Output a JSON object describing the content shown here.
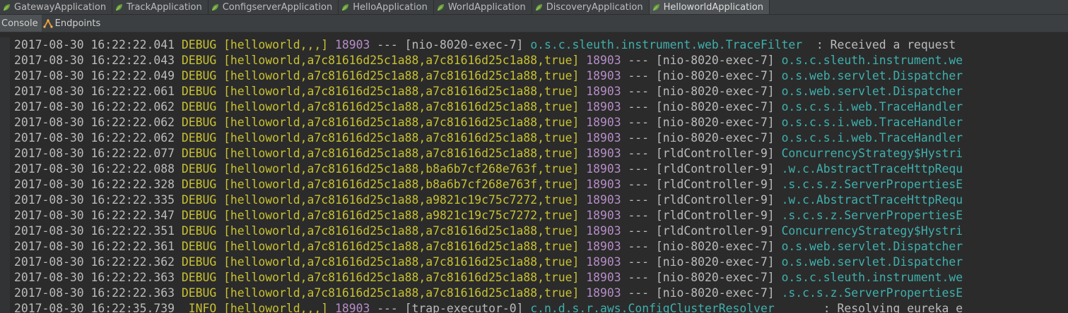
{
  "tabs": [
    {
      "label": "GatewayApplication",
      "icon": "spring-leaf-icon",
      "active": false
    },
    {
      "label": "TrackApplication",
      "icon": "spring-leaf-icon",
      "active": false
    },
    {
      "label": "ConfigserverApplication",
      "icon": "spring-leaf-icon",
      "active": false
    },
    {
      "label": "HelloApplication",
      "icon": "spring-leaf-icon",
      "active": false
    },
    {
      "label": "WorldApplication",
      "icon": "spring-leaf-icon",
      "active": false
    },
    {
      "label": "DiscoveryApplication",
      "icon": "spring-leaf-icon",
      "active": false
    },
    {
      "label": "HelloworldApplication",
      "icon": "spring-leaf-icon",
      "active": true
    }
  ],
  "toolbar": {
    "console_label": "Console",
    "endpoints_label": "Endpoints",
    "endpoints_icon": "endpoints-icon"
  },
  "colors": {
    "background": "#2b2b2b",
    "level": "#c8c132",
    "pid": "#b68dc9",
    "logger": "#3fb0ad",
    "text": "#bbbbbb"
  },
  "log_lines": [
    {
      "ts": "2017-08-30 16:22:22.041",
      "level": "DEBUG",
      "trace": "[helloworld,,,]",
      "pid": "18903",
      "sep": "---",
      "thread": "[nio-8020-exec-7]",
      "logger": "o.s.c.sleuth.instrument.web.TraceFilter",
      "msg": "  : Received a request"
    },
    {
      "ts": "2017-08-30 16:22:22.043",
      "level": "DEBUG",
      "trace": "[helloworld,a7c81616d25c1a88,a7c81616d25c1a88,true]",
      "pid": "18903",
      "sep": "---",
      "thread": "[nio-8020-exec-7]",
      "logger": "o.s.c.sleuth.instrument.we",
      "msg": ""
    },
    {
      "ts": "2017-08-30 16:22:22.049",
      "level": "DEBUG",
      "trace": "[helloworld,a7c81616d25c1a88,a7c81616d25c1a88,true]",
      "pid": "18903",
      "sep": "---",
      "thread": "[nio-8020-exec-7]",
      "logger": "o.s.web.servlet.Dispatcher",
      "msg": ""
    },
    {
      "ts": "2017-08-30 16:22:22.061",
      "level": "DEBUG",
      "trace": "[helloworld,a7c81616d25c1a88,a7c81616d25c1a88,true]",
      "pid": "18903",
      "sep": "---",
      "thread": "[nio-8020-exec-7]",
      "logger": "o.s.web.servlet.Dispatcher",
      "msg": ""
    },
    {
      "ts": "2017-08-30 16:22:22.062",
      "level": "DEBUG",
      "trace": "[helloworld,a7c81616d25c1a88,a7c81616d25c1a88,true]",
      "pid": "18903",
      "sep": "---",
      "thread": "[nio-8020-exec-7]",
      "logger": "o.s.c.s.i.web.TraceHandler",
      "msg": ""
    },
    {
      "ts": "2017-08-30 16:22:22.062",
      "level": "DEBUG",
      "trace": "[helloworld,a7c81616d25c1a88,a7c81616d25c1a88,true]",
      "pid": "18903",
      "sep": "---",
      "thread": "[nio-8020-exec-7]",
      "logger": "o.s.c.s.i.web.TraceHandler",
      "msg": ""
    },
    {
      "ts": "2017-08-30 16:22:22.062",
      "level": "DEBUG",
      "trace": "[helloworld,a7c81616d25c1a88,a7c81616d25c1a88,true]",
      "pid": "18903",
      "sep": "---",
      "thread": "[nio-8020-exec-7]",
      "logger": "o.s.c.s.i.web.TraceHandler",
      "msg": ""
    },
    {
      "ts": "2017-08-30 16:22:22.077",
      "level": "DEBUG",
      "trace": "[helloworld,a7c81616d25c1a88,a7c81616d25c1a88,true]",
      "pid": "18903",
      "sep": "---",
      "thread": "[rldController-9]",
      "logger": "ConcurrencyStrategy$Hystri",
      "msg": ""
    },
    {
      "ts": "2017-08-30 16:22:22.088",
      "level": "DEBUG",
      "trace": "[helloworld,a7c81616d25c1a88,b8a6b7cf268e763f,true]",
      "pid": "18903",
      "sep": "---",
      "thread": "[rldController-9]",
      "logger": ".w.c.AbstractTraceHttpRequ",
      "msg": ""
    },
    {
      "ts": "2017-08-30 16:22:22.328",
      "level": "DEBUG",
      "trace": "[helloworld,a7c81616d25c1a88,b8a6b7cf268e763f,true]",
      "pid": "18903",
      "sep": "---",
      "thread": "[rldController-9]",
      "logger": ".s.c.s.z.ServerPropertiesE",
      "msg": ""
    },
    {
      "ts": "2017-08-30 16:22:22.335",
      "level": "DEBUG",
      "trace": "[helloworld,a7c81616d25c1a88,a9821c19c75c7272,true]",
      "pid": "18903",
      "sep": "---",
      "thread": "[rldController-9]",
      "logger": ".w.c.AbstractTraceHttpRequ",
      "msg": ""
    },
    {
      "ts": "2017-08-30 16:22:22.347",
      "level": "DEBUG",
      "trace": "[helloworld,a7c81616d25c1a88,a9821c19c75c7272,true]",
      "pid": "18903",
      "sep": "---",
      "thread": "[rldController-9]",
      "logger": ".s.c.s.z.ServerPropertiesE",
      "msg": ""
    },
    {
      "ts": "2017-08-30 16:22:22.351",
      "level": "DEBUG",
      "trace": "[helloworld,a7c81616d25c1a88,a7c81616d25c1a88,true]",
      "pid": "18903",
      "sep": "---",
      "thread": "[rldController-9]",
      "logger": "ConcurrencyStrategy$Hystri",
      "msg": ""
    },
    {
      "ts": "2017-08-30 16:22:22.361",
      "level": "DEBUG",
      "trace": "[helloworld,a7c81616d25c1a88,a7c81616d25c1a88,true]",
      "pid": "18903",
      "sep": "---",
      "thread": "[nio-8020-exec-7]",
      "logger": "o.s.web.servlet.Dispatcher",
      "msg": ""
    },
    {
      "ts": "2017-08-30 16:22:22.362",
      "level": "DEBUG",
      "trace": "[helloworld,a7c81616d25c1a88,a7c81616d25c1a88,true]",
      "pid": "18903",
      "sep": "---",
      "thread": "[nio-8020-exec-7]",
      "logger": "o.s.web.servlet.Dispatcher",
      "msg": ""
    },
    {
      "ts": "2017-08-30 16:22:22.363",
      "level": "DEBUG",
      "trace": "[helloworld,a7c81616d25c1a88,a7c81616d25c1a88,true]",
      "pid": "18903",
      "sep": "---",
      "thread": "[nio-8020-exec-7]",
      "logger": "o.s.c.sleuth.instrument.we",
      "msg": ""
    },
    {
      "ts": "2017-08-30 16:22:22.363",
      "level": "DEBUG",
      "trace": "[helloworld,a7c81616d25c1a88,a7c81616d25c1a88,true]",
      "pid": "18903",
      "sep": "---",
      "thread": "[nio-8020-exec-7]",
      "logger": ".s.c.s.z.ServerPropertiesE",
      "msg": ""
    },
    {
      "ts": "2017-08-30 16:22:35.739",
      "level": " INFO",
      "trace": "[helloworld,,,]",
      "pid": "18903",
      "sep": "---",
      "thread": "[trap-executor-0]",
      "logger": "c.n.d.s.r.aws.ConfigClusterResolver",
      "msg": "       : Resolving eureka e"
    }
  ]
}
